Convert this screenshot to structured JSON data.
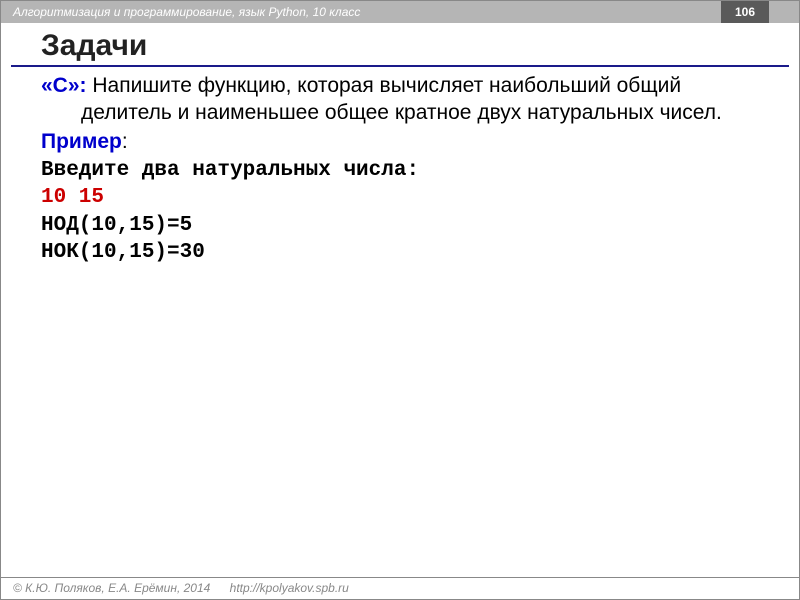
{
  "header": {
    "breadcrumb": "Алгоритмизация и программирование, язык Python, 10 класс",
    "page_number": "106"
  },
  "title": "Задачи",
  "task": {
    "label": "«С»:",
    "text": " Напишите функцию, которая вычисляет наибольший общий делитель и наименьшее общее кратное двух натуральных чисел."
  },
  "example": {
    "label": "Пример",
    "colon": ":",
    "prompt": "Введите два натуральных числа:",
    "input": "10 15",
    "out1": "НОД(10,15)=5",
    "out2": "НОК(10,15)=30"
  },
  "footer": {
    "copyright": "© К.Ю. Поляков, Е.А. Ерёмин, 2014",
    "url": "http://kpolyakov.spb.ru"
  }
}
